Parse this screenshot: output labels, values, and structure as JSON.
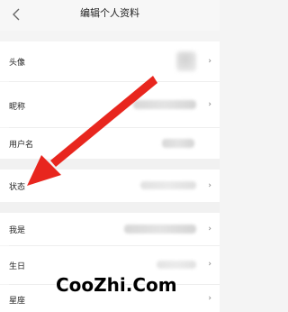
{
  "header": {
    "back_icon": "chevron-left-icon",
    "title": "编辑个人资料"
  },
  "rows": [
    {
      "label": "头像"
    },
    {
      "label": "昵称"
    },
    {
      "label": "用户名"
    },
    {
      "label": "状态"
    },
    {
      "label": "我是"
    },
    {
      "label": "生日"
    },
    {
      "label": "星座"
    }
  ],
  "chevron": "›",
  "annotation": {
    "arrow_color": "#e8261e"
  },
  "watermark": "CooZhi.Com"
}
